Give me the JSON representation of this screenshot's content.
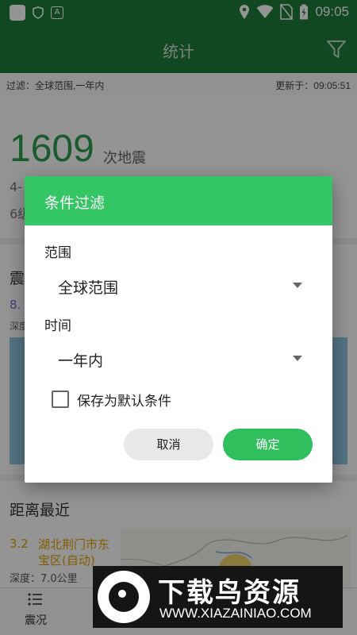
{
  "status_bar": {
    "time": "09:05"
  },
  "app_bar": {
    "title": "统计"
  },
  "filter_bar": {
    "filter": "过滤：全球范围,一年内",
    "updated": "更新于：09:05:51"
  },
  "summary": {
    "count": "1609",
    "count_unit": "次地震",
    "line1_partial": "4-",
    "line2_partial": "6级"
  },
  "section_quake": {
    "title_partial": "震",
    "mag_partial": "8.",
    "depth_partial": "深度"
  },
  "section_nearest": {
    "title": "距离最近",
    "magnitude": "3.2",
    "place": "湖北荆门市东宝区(自动)",
    "depth": "深度：7.0公里"
  },
  "bottom_nav": {
    "item_label": "震况"
  },
  "dialog": {
    "title": "条件过滤",
    "range_label": "范围",
    "range_value": "全球范围",
    "time_label": "时间",
    "time_value": "一年内",
    "checkbox_label": "保存为默认条件",
    "checkbox_checked": false,
    "cancel": "取消",
    "confirm": "确定"
  },
  "watermark": {
    "title": "下载鸟资源",
    "url": "WWW.XIAZAINIAO.COM"
  },
  "colors": {
    "appbar": "#1e7d3a",
    "dialog_header": "#34c564",
    "confirm_button": "#2fbf5c",
    "count": "#2c9e4c",
    "nearest": "#e0a000"
  }
}
